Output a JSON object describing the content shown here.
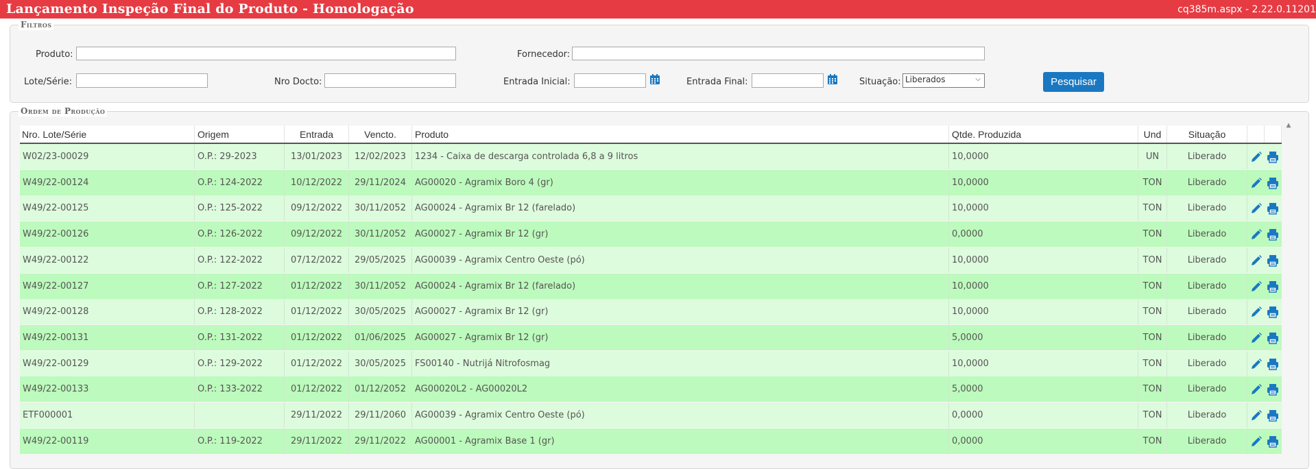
{
  "header": {
    "title": "Lançamento Inspeção Final do Produto  - Homologação",
    "version": "cq385m.aspx - 2.22.0.11201"
  },
  "filters": {
    "legend": "Filtros",
    "produto_label": "Produto:",
    "produto_value": "",
    "fornecedor_label": "Fornecedor:",
    "fornecedor_value": "",
    "lote_label": "Lote/Série:",
    "lote_value": "",
    "nrodocto_label": "Nro Docto:",
    "nrodocto_value": "",
    "entrada_inicial_label": "Entrada Inicial:",
    "entrada_inicial_value": "",
    "entrada_final_label": "Entrada Final:",
    "entrada_final_value": "",
    "situacao_label": "Situação:",
    "situacao_value": "Liberados",
    "search_button": "Pesquisar"
  },
  "grid": {
    "legend": "Ordem de Produção",
    "columns": [
      "Nro. Lote/Série",
      "Origem",
      "Entrada",
      "Vencto.",
      "Produto",
      "Qtde. Produzida",
      "Und",
      "Situação"
    ],
    "rows": [
      {
        "lote": "W02/23-00029",
        "origem": "O.P.: 29-2023",
        "entrada": "13/01/2023",
        "vencto": "12/02/2023",
        "produto": "1234 - Caixa de descarga controlada 6,8 a 9 litros",
        "qtde": "10,0000",
        "und": "UN",
        "situacao": "Liberado"
      },
      {
        "lote": "W49/22-00124",
        "origem": "O.P.: 124-2022",
        "entrada": "10/12/2022",
        "vencto": "29/11/2024",
        "produto": "AG00020 - Agramix Boro 4 (gr)",
        "qtde": "10,0000",
        "und": "TON",
        "situacao": "Liberado"
      },
      {
        "lote": "W49/22-00125",
        "origem": "O.P.: 125-2022",
        "entrada": "09/12/2022",
        "vencto": "30/11/2052",
        "produto": "AG00024 - Agramix Br 12 (farelado)",
        "qtde": "10,0000",
        "und": "TON",
        "situacao": "Liberado"
      },
      {
        "lote": "W49/22-00126",
        "origem": "O.P.: 126-2022",
        "entrada": "09/12/2022",
        "vencto": "30/11/2052",
        "produto": "AG00027 - Agramix Br 12 (gr)",
        "qtde": "0,0000",
        "und": "TON",
        "situacao": "Liberado"
      },
      {
        "lote": "W49/22-00122",
        "origem": "O.P.: 122-2022",
        "entrada": "07/12/2022",
        "vencto": "29/05/2025",
        "produto": "AG00039 - Agramix Centro Oeste (pó)",
        "qtde": "10,0000",
        "und": "TON",
        "situacao": "Liberado"
      },
      {
        "lote": "W49/22-00127",
        "origem": "O.P.: 127-2022",
        "entrada": "01/12/2022",
        "vencto": "30/11/2052",
        "produto": "AG00024 - Agramix Br 12 (farelado)",
        "qtde": "10,0000",
        "und": "TON",
        "situacao": "Liberado"
      },
      {
        "lote": "W49/22-00128",
        "origem": "O.P.: 128-2022",
        "entrada": "01/12/2022",
        "vencto": "30/05/2025",
        "produto": "AG00027 - Agramix Br 12 (gr)",
        "qtde": "10,0000",
        "und": "TON",
        "situacao": "Liberado"
      },
      {
        "lote": "W49/22-00131",
        "origem": "O.P.: 131-2022",
        "entrada": "01/12/2022",
        "vencto": "01/06/2025",
        "produto": "AG00027 - Agramix Br 12 (gr)",
        "qtde": "5,0000",
        "und": "TON",
        "situacao": "Liberado"
      },
      {
        "lote": "W49/22-00129",
        "origem": "O.P.: 129-2022",
        "entrada": "01/12/2022",
        "vencto": "30/05/2025",
        "produto": "FS00140 - Nutrijá Nitrofosmag",
        "qtde": "10,0000",
        "und": "TON",
        "situacao": "Liberado"
      },
      {
        "lote": "W49/22-00133",
        "origem": "O.P.: 133-2022",
        "entrada": "01/12/2022",
        "vencto": "01/12/2052",
        "produto": "AG00020L2 - AG00020L2",
        "qtde": "5,0000",
        "und": "TON",
        "situacao": "Liberado"
      },
      {
        "lote": "ETF000001",
        "origem": "",
        "entrada": "29/11/2022",
        "vencto": "29/11/2060",
        "produto": "AG00039 - Agramix Centro Oeste (pó)",
        "qtde": "0,0000",
        "und": "TON",
        "situacao": "Liberado"
      },
      {
        "lote": "W49/22-00119",
        "origem": "O.P.: 119-2022",
        "entrada": "29/11/2022",
        "vencto": "29/11/2022",
        "produto": "AG00001 - Agramix Base 1 (gr)",
        "qtde": "0,0000",
        "und": "TON",
        "situacao": "Liberado"
      }
    ]
  },
  "colors": {
    "header_bg": "#e63b43",
    "row_light": "#ddfbdd",
    "row_dark": "#bdfabd",
    "button": "#1a78c2",
    "icon_blue": "#1a78c2"
  },
  "icons": [
    "calendar-icon",
    "edit-pencil-icon",
    "printer-icon"
  ]
}
